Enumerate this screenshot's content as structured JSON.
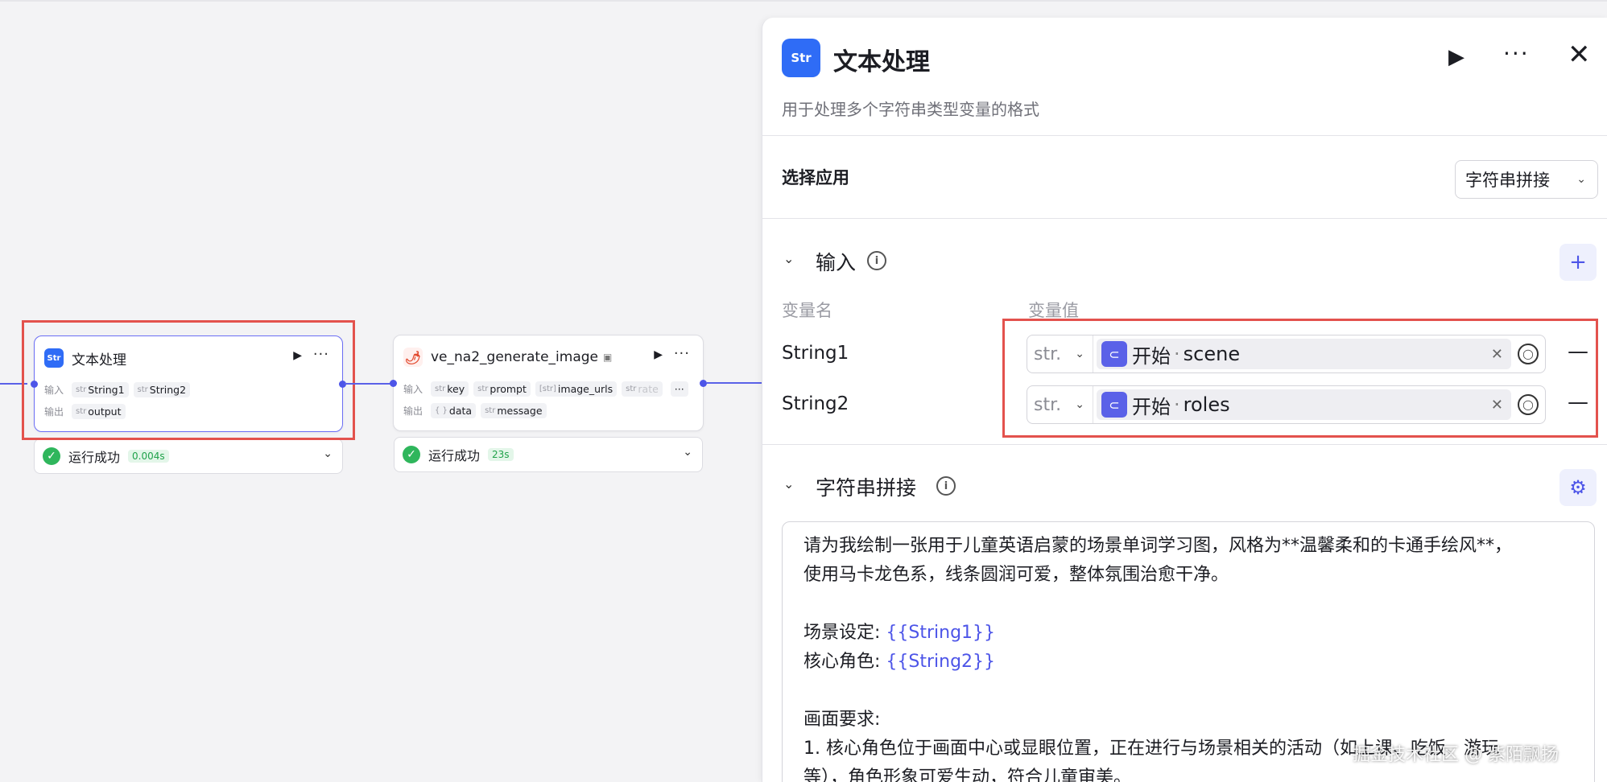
{
  "nodes": {
    "text_process": {
      "title": "文本处理",
      "icon": "Str",
      "input_label": "输入",
      "output_label": "输出",
      "inputs": [
        {
          "type": "str",
          "name": "String1"
        },
        {
          "type": "str",
          "name": "String2"
        }
      ],
      "outputs": [
        {
          "type": "str",
          "name": "output"
        }
      ],
      "status": "运行成功",
      "status_time": "0.004s"
    },
    "generate_image": {
      "title": "ve_na2_generate_image",
      "input_label": "输入",
      "output_label": "输出",
      "inputs": [
        {
          "type": "str",
          "name": "key"
        },
        {
          "type": "str",
          "name": "prompt"
        },
        {
          "type": "[str]",
          "name": "image_urls"
        },
        {
          "type": "str",
          "name": "rate"
        }
      ],
      "outputs": [
        {
          "type": "{ }",
          "name": "data"
        },
        {
          "type": "str",
          "name": "message"
        }
      ],
      "status": "运行成功",
      "status_time": "23s"
    }
  },
  "panel": {
    "title": "文本处理",
    "icon": "Str",
    "description": "用于处理多个字符串类型变量的格式",
    "select_app_label": "选择应用",
    "select_app_value": "字符串拼接",
    "input_section_title": "输入",
    "col_var_name": "变量名",
    "col_var_value": "变量值",
    "variables": [
      {
        "name": "String1",
        "type": "str.",
        "ref_source": "开始",
        "ref_sep": "·",
        "ref_field": "scene"
      },
      {
        "name": "String2",
        "type": "str.",
        "ref_source": "开始",
        "ref_sep": "·",
        "ref_field": "roles"
      }
    ],
    "concat_section_title": "字符串拼接",
    "template_lines": [
      "请为我绘制一张用于儿童英语启蒙的场景单词学习图，风格为**温馨柔和的卡通手绘风**，",
      "使用马卡龙色系，线条圆润可爱，整体氛围治愈干净。",
      "",
      "场景设定: ",
      "核心角色: ",
      "",
      "画面要求:",
      "1. 核心角色位于画面中心或显眼位置，正在进行与场景相关的活动（如上课、吃饭、游玩",
      "等），角色形象可爱生动，符合儿童审美。"
    ],
    "template_vars": [
      "{{String1}}",
      "{{String2}}"
    ]
  },
  "watermark": "掘金技术社区 @ 紫陌飘扬",
  "colors": {
    "accent": "#4d55e8",
    "highlight_box": "#e3524d",
    "success": "#2fb65c",
    "brand_blue": "#2f6cf6"
  }
}
